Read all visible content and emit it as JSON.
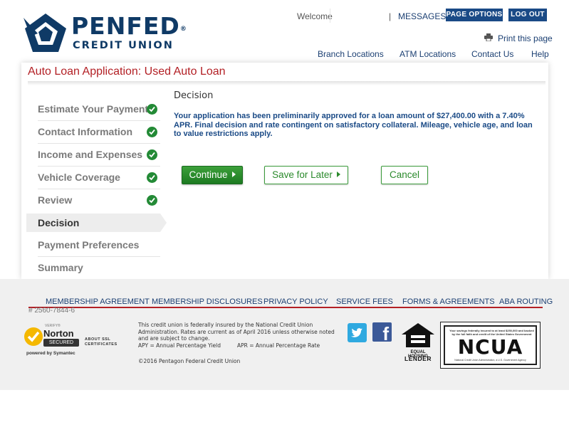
{
  "header": {
    "logo_name": "PENFED",
    "logo_reg": "®",
    "logo_sub": "CREDIT UNION",
    "welcome": "Welcome",
    "separator": "|",
    "messages": "MESSAGES",
    "page_options": "PAGE OPTIONS ▾",
    "logout": "LOG OUT",
    "print": "Print this page",
    "nav": [
      "Branch Locations",
      "ATM Locations",
      "Contact Us",
      "Help"
    ]
  },
  "page_title": "Auto Loan Application: Used Auto Loan",
  "steps": [
    {
      "label": "Estimate Your Payment",
      "complete": true
    },
    {
      "label": "Contact Information",
      "complete": true
    },
    {
      "label": "Income and Expenses",
      "complete": true
    },
    {
      "label": "Vehicle Coverage",
      "complete": true
    },
    {
      "label": "Review",
      "complete": true
    },
    {
      "label": "Decision",
      "active": true
    },
    {
      "label": "Payment Preferences"
    },
    {
      "label": "Summary"
    }
  ],
  "decision": {
    "heading": "Decision",
    "message": "Your application has been preliminarily approved for a loan amount of $27,400.00 with a 7.40% APR. Final decision and rate contingent on satisfactory collateral. Mileage, vehicle age, and loan to value restrictions apply."
  },
  "actions": {
    "continue": "Continue",
    "save_later": "Save for Later",
    "cancel": "Cancel"
  },
  "footer": {
    "links": [
      "MEMBERSHIP AGREEMENT",
      "MEMBERSHIP DISCLOSURES",
      "PRIVACY POLICY",
      "SERVICE FEES",
      "FORMS & AGREEMENTS",
      "ABA ROUTING"
    ],
    "routing_number": "# 2560-7844-6",
    "norton": {
      "verify": "VERIFY®",
      "brand": "Norton",
      "secured": "SECURED",
      "by": "powered by Symantec",
      "about_1": "ABOUT SSL",
      "about_2": "CERTIFICATES"
    },
    "legal_1": "This credit union is federally insured by the National Credit Union Administration. Rates are current as of April 2016 unless otherwise noted and are subject to change.",
    "legal_apy": "APY = Annual Percentage Yield",
    "legal_apr": "APR = Annual Percentage Rate",
    "copyright": "©2016 Pentagon Federal Credit Union",
    "ehl_1": "EQUAL HOUSING",
    "ehl_2": "LENDER",
    "ncua_top": "Your savings federally insured to at least $250,000 and backed by the full faith and credit of the United States Government",
    "ncua": "NCUA",
    "ncua_bottom": "National Credit Union Administration, a U.S. Government Agency"
  },
  "colors": {
    "brand_navy": "#0f3a66",
    "title_red": "#b32025",
    "approve_green": "#238a36"
  }
}
